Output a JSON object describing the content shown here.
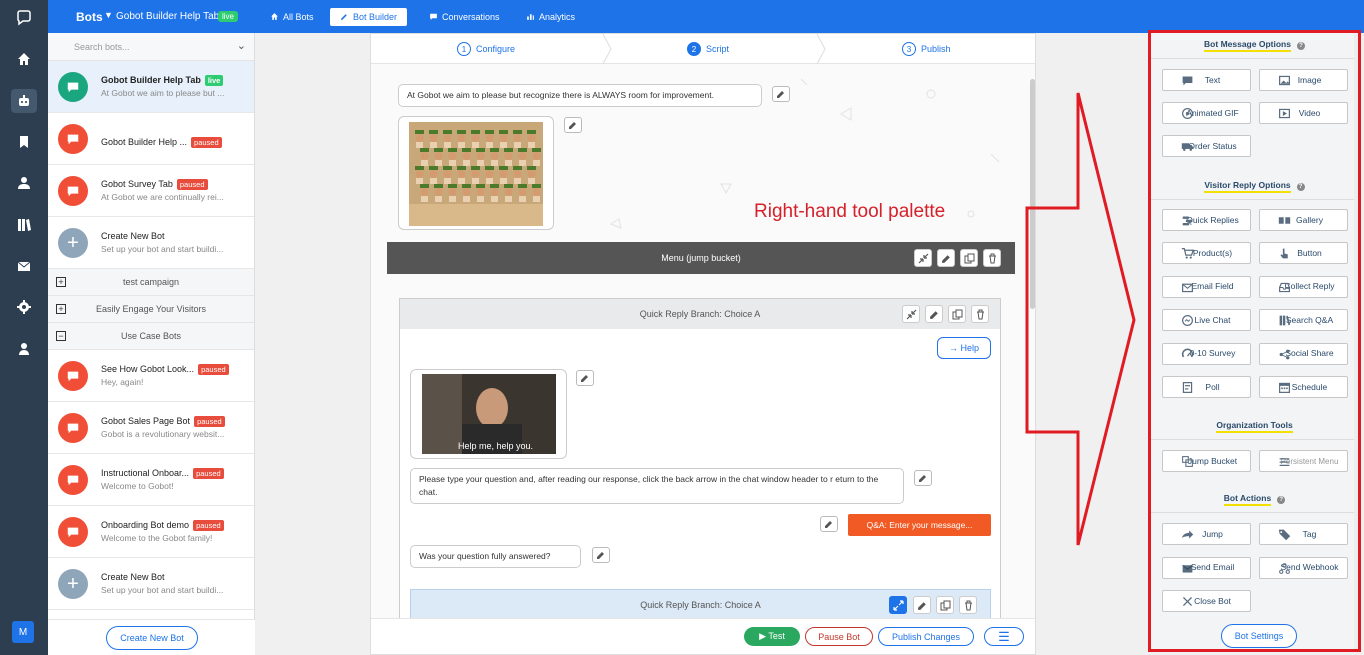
{
  "topbar": {
    "brand": "Bots",
    "bot_name": "Gobot Builder Help Tab",
    "status": "live",
    "nav": [
      {
        "label": "All Bots",
        "icon": "home-icon"
      },
      {
        "label": "Bot Builder",
        "icon": "pencil-icon",
        "active": true
      },
      {
        "label": "Conversations",
        "icon": "chat-icon"
      },
      {
        "label": "Analytics",
        "icon": "bar-chart-icon"
      }
    ]
  },
  "rail": {
    "icons": [
      "home-icon",
      "robot-icon",
      "bookmark-icon",
      "user-icon",
      "library-icon",
      "mail-icon",
      "gear-icon",
      "person-icon"
    ],
    "avatar": "M"
  },
  "sidebar": {
    "search_placeholder": "Search bots...",
    "create_button": "Create New Bot",
    "bots_top": [
      {
        "title": "Gobot Builder Help Tab",
        "badge": "live",
        "subtitle": "At Gobot we aim to please but ...",
        "color": "#1aa67e",
        "selected": true
      },
      {
        "title": "Gobot Builder Help ...",
        "badge": "paused",
        "subtitle": "",
        "color": "#f04e37"
      },
      {
        "title": "Gobot Survey Tab",
        "badge": "paused",
        "subtitle": "At Gobot we are continually rei...",
        "color": "#f04e37"
      },
      {
        "title": "Create New Bot",
        "badge": "",
        "subtitle": "Set up your bot and start buildi...",
        "color": "#8fa6ba",
        "plus": true
      }
    ],
    "groups": [
      {
        "label": "test campaign",
        "sign": "+"
      },
      {
        "label": "Easily Engage Your Visitors",
        "sign": "+"
      },
      {
        "label": "Use Case Bots",
        "sign": "−"
      }
    ],
    "bots_bottom": [
      {
        "title": "See How Gobot Look...",
        "badge": "paused",
        "subtitle": "Hey, again!",
        "color": "#f04e37"
      },
      {
        "title": "Gobot Sales Page Bot",
        "badge": "paused",
        "subtitle": "Gobot is a revolutionary websit...",
        "color": "#f04e37"
      },
      {
        "title": "Instructional Onboar...",
        "badge": "paused",
        "subtitle": "Welcome to Gobot!",
        "color": "#f04e37"
      },
      {
        "title": "Onboarding Bot demo",
        "badge": "paused",
        "subtitle": "Welcome to the Gobot family!",
        "color": "#f04e37"
      },
      {
        "title": "Create New Bot",
        "badge": "",
        "subtitle": "Set up your bot and start buildi...",
        "color": "#8fa6ba",
        "plus": true
      }
    ]
  },
  "steps": [
    {
      "num": "1",
      "label": "Configure"
    },
    {
      "num": "2",
      "label": "Script"
    },
    {
      "num": "3",
      "label": "Publish"
    }
  ],
  "canvas": {
    "msg1": "At Gobot we aim to please but recognize there is ALWAYS room for improvement.",
    "menu_title": "Menu (jump bucket)",
    "branch_a": "Quick Reply Branch: Choice A",
    "help_button": "→ Help",
    "gif_caption": "Help me, help you.",
    "msg2": "Please type your question and, after reading our response, click the back arrow in the chat window header to r eturn to the chat.",
    "qa_button": "Q&A: Enter your message...",
    "msg3": "Was your question fully answered?",
    "branch_b": "Quick Reply Branch: Choice A"
  },
  "footer": {
    "test": "▶ Test",
    "pause": "Pause Bot",
    "publish": "Publish Changes"
  },
  "annotation": "Right-hand tool palette",
  "palette": {
    "bot_message_title": "Bot Message Options",
    "bot_message": [
      {
        "label": "Text",
        "icon": "chat-icon"
      },
      {
        "label": "Image",
        "icon": "image-icon"
      },
      {
        "label": "Animated GIF",
        "icon": "gif-icon"
      },
      {
        "label": "Video",
        "icon": "video-icon"
      },
      {
        "label": "Order Status",
        "icon": "truck-icon"
      }
    ],
    "visitor_title": "Visitor Reply Options",
    "visitor": [
      {
        "label": "Quick Replies",
        "icon": "quick-replies-icon"
      },
      {
        "label": "Gallery",
        "icon": "gallery-icon"
      },
      {
        "label": "Product(s)",
        "icon": "cart-icon"
      },
      {
        "label": "Button",
        "icon": "pointer-icon"
      },
      {
        "label": "Email Field",
        "icon": "envelope-icon"
      },
      {
        "label": "Collect Reply",
        "icon": "inbox-icon"
      },
      {
        "label": "Live Chat",
        "icon": "livechat-icon"
      },
      {
        "label": "Search Q&A",
        "icon": "books-icon"
      },
      {
        "label": "0-10 Survey",
        "icon": "gauge-icon"
      },
      {
        "label": "Social Share",
        "icon": "share-icon"
      },
      {
        "label": "Poll",
        "icon": "poll-icon"
      },
      {
        "label": "Schedule",
        "icon": "calendar-icon"
      }
    ],
    "org_title": "Organization Tools",
    "org": [
      {
        "label": "Jump Bucket",
        "icon": "bucket-icon"
      },
      {
        "label": "Persistent Menu",
        "icon": "menu-lines-icon",
        "dim": true
      }
    ],
    "actions_title": "Bot Actions",
    "actions": [
      {
        "label": "Jump",
        "icon": "jump-arrow-icon"
      },
      {
        "label": "Tag",
        "icon": "tag-icon"
      },
      {
        "label": "Send Email",
        "icon": "mail-icon"
      },
      {
        "label": "Send Webhook",
        "icon": "webhook-icon"
      },
      {
        "label": "Close Bot",
        "icon": "close-icon"
      }
    ],
    "settings_button": "Bot Settings"
  },
  "colors": {
    "primary": "#1e73e8",
    "rail": "#2d3e50",
    "orange": "#f15a24",
    "annotation": "#e01b24",
    "highlight": "#f4e000"
  }
}
